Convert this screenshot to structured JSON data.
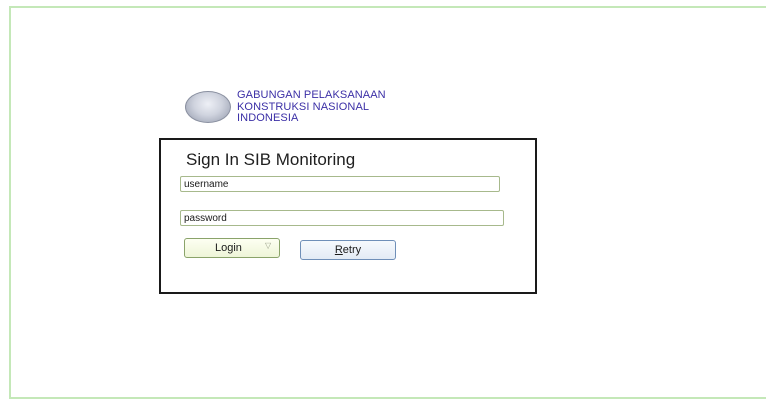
{
  "logo": {
    "line1": "GABUNGAN PELAKSANAAN",
    "line2": "KONSTRUKSI NASIONAL",
    "line3": "INDONESIA",
    "icon": "globe-emblem-icon",
    "text_color": "#3b2fa6"
  },
  "signin": {
    "title": "Sign In SIB Monitoring",
    "username": {
      "value": "username",
      "placeholder": ""
    },
    "password": {
      "value": "password",
      "placeholder": ""
    },
    "login_button": {
      "label": "Login",
      "indicator_icon": "triangle-indicator-icon"
    },
    "retry_button": {
      "label_first": "R",
      "label_rest": "etry"
    }
  },
  "colors": {
    "frame_border": "#c4e8b8",
    "panel_border": "#1a1a1a",
    "login_border": "#8aa36a",
    "retry_border": "#6f8fb8"
  }
}
